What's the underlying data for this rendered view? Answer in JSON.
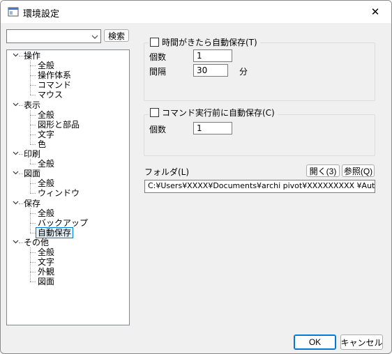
{
  "window": {
    "title": "環境設定",
    "close_glyph": "✕"
  },
  "search": {
    "value": "",
    "button_label": "検索"
  },
  "tree": {
    "selected": "自動保存",
    "groups": [
      {
        "label": "操作",
        "expanded": true,
        "children": [
          "全般",
          "操作体系",
          "コマンド",
          "マウス"
        ]
      },
      {
        "label": "表示",
        "expanded": true,
        "children": [
          "全般",
          "図形と部品",
          "文字",
          "色"
        ]
      },
      {
        "label": "印刷",
        "expanded": true,
        "children": [
          "全般"
        ]
      },
      {
        "label": "図面",
        "expanded": true,
        "children": [
          "全般",
          "ウィンドウ"
        ]
      },
      {
        "label": "保存",
        "expanded": true,
        "children": [
          "全般",
          "バックアップ",
          "自動保存"
        ]
      },
      {
        "label": "その他",
        "expanded": true,
        "children": [
          "全般",
          "文字",
          "外観",
          "図面"
        ]
      }
    ]
  },
  "autosave_time": {
    "checkbox_label": "時間がきたら自動保存(T)",
    "checked": false,
    "count_label": "個数",
    "count_value": "1",
    "interval_label": "間隔",
    "interval_value": "30",
    "interval_unit": "分"
  },
  "autosave_command": {
    "checkbox_label": "コマンド実行前に自動保存(C)",
    "checked": false,
    "count_label": "個数",
    "count_value": "1"
  },
  "folder": {
    "label": "フォルダ(L)",
    "open_button": "開く(3)",
    "browse_button": "参照(Q)",
    "path": "C:¥Users¥XXXX¥Documents¥archi pivot¥XXXXXXXXX ¥AutoSave"
  },
  "footer": {
    "ok_label": "OK",
    "cancel_label": "キャンセル"
  },
  "colors": {
    "selection_border": "#0078d7",
    "selection_fill": "#e5f1fb",
    "ok_border": "#0078d7"
  }
}
